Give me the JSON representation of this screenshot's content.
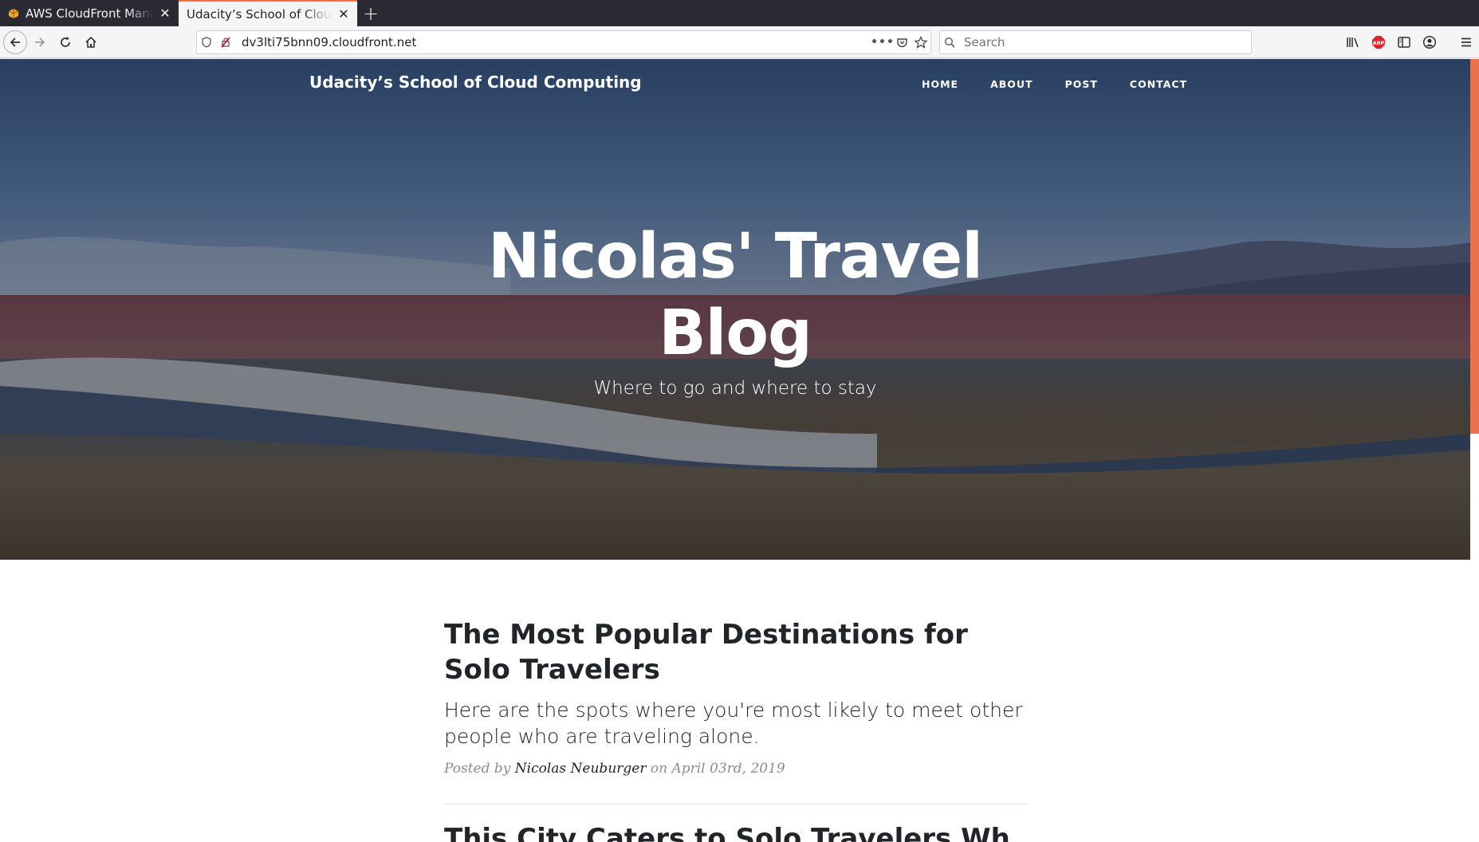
{
  "browser": {
    "tabs": [
      {
        "title": "AWS CloudFront Manag",
        "active": false
      },
      {
        "title": "Udacity’s School of Cloud C",
        "active": true
      }
    ],
    "url": "dv3lti75bnn09.cloudfront.net",
    "search_placeholder": "Search",
    "url_actions_label": "•••"
  },
  "site": {
    "brand": "Udacity’s School of Cloud Computing",
    "menu": [
      "HOME",
      "ABOUT",
      "POST",
      "CONTACT"
    ],
    "hero_title": "Nicolas' Travel Blog",
    "hero_subtitle": "Where to go and where to stay"
  },
  "posts": [
    {
      "title": "The Most Popular Destinations for Solo Travelers",
      "subtitle": "Here are the spots where you're most likely to meet other people who are traveling alone.",
      "posted_by_label": "Posted by",
      "author": "Nicolas Neuburger",
      "date_label": "on April 03rd, 2019"
    },
    {
      "title": "This City Caters to Solo Travelers Wh"
    }
  ],
  "colors": {
    "accent": "#ff6a3d",
    "scroll_thumb": "#e9714c",
    "text_dark": "#212529",
    "meta_gray": "#868e96"
  }
}
